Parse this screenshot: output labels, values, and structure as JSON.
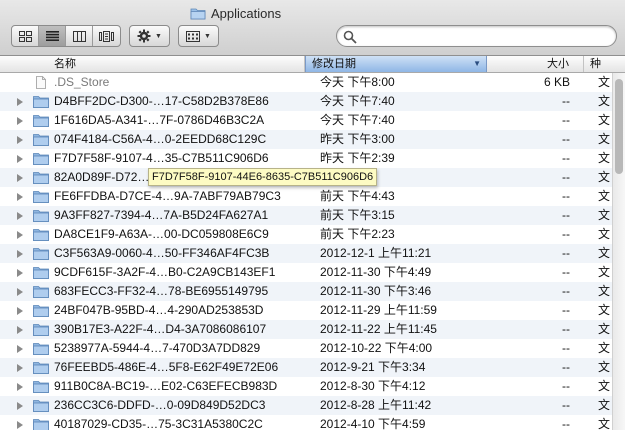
{
  "window": {
    "title": "Applications"
  },
  "toolbar": {
    "view_buttons": [
      {
        "icon": "icon-view-icon",
        "active": false
      },
      {
        "icon": "list-view-icon",
        "active": true
      },
      {
        "icon": "column-view-icon",
        "active": false
      },
      {
        "icon": "coverflow-view-icon",
        "active": false
      }
    ],
    "action_icon": "gear-icon",
    "arrange_icon": "arrange-grid-icon",
    "search": {
      "placeholder": "",
      "value": ""
    }
  },
  "columns": {
    "name": "名称",
    "date": "修改日期",
    "size": "大小",
    "kind": "种"
  },
  "tooltip": "F7D7F58F-9107-44E6-8635-C7B511C906D6",
  "rows": [
    {
      "name": ".DS_Store",
      "date": "今天 下午8:00",
      "size": "6 KB",
      "kind": "文",
      "type": "file"
    },
    {
      "name": "D4BFF2DC-D300-…17-C58D2B378E86",
      "date": "今天 下午7:40",
      "size": "--",
      "kind": "文",
      "type": "folder"
    },
    {
      "name": "1F616DA5-A341-…7F-0786D46B3C2A",
      "date": "今天 下午7:40",
      "size": "--",
      "kind": "文",
      "type": "folder"
    },
    {
      "name": "074F4184-C56A-4…0-2EEDD68C129C",
      "date": "昨天 下午3:00",
      "size": "--",
      "kind": "文",
      "type": "folder"
    },
    {
      "name": "F7D7F58F-9107-4…35-C7B511C906D6",
      "date": "昨天 下午2:39",
      "size": "--",
      "kind": "文",
      "type": "folder"
    },
    {
      "name": "82A0D89F-D72…",
      "date": "",
      "size": "--",
      "kind": "文",
      "type": "folder"
    },
    {
      "name": "FE6FFDBA-D7CE-4…9A-7ABF79AB79C3",
      "date": "前天 下午4:43",
      "size": "--",
      "kind": "文",
      "type": "folder"
    },
    {
      "name": "9A3FF827-7394-4…7A-B5D24FA627A1",
      "date": "前天 下午3:15",
      "size": "--",
      "kind": "文",
      "type": "folder"
    },
    {
      "name": "DA8CE1F9-A63A-…00-DC059808E6C9",
      "date": "前天 下午2:23",
      "size": "--",
      "kind": "文",
      "type": "folder"
    },
    {
      "name": "C3F563A9-0060-4…50-FF346AF4FC3B",
      "date": "2012-12-1 上午11:21",
      "size": "--",
      "kind": "文",
      "type": "folder"
    },
    {
      "name": "9CDF615F-3A2F-4…B0-C2A9CB143EF1",
      "date": "2012-11-30 下午4:49",
      "size": "--",
      "kind": "文",
      "type": "folder"
    },
    {
      "name": "683FECC3-FF32-4…78-BE6955149795",
      "date": "2012-11-30 下午3:46",
      "size": "--",
      "kind": "文",
      "type": "folder"
    },
    {
      "name": "24BF047B-95BD-4…4-290AD253853D",
      "date": "2012-11-29 上午11:59",
      "size": "--",
      "kind": "文",
      "type": "folder"
    },
    {
      "name": "390B17E3-A22F-4…D4-3A7086086107",
      "date": "2012-11-22 上午11:45",
      "size": "--",
      "kind": "文",
      "type": "folder"
    },
    {
      "name": "5238977A-5944-4…7-470D3A7DD829",
      "date": "2012-10-22 下午4:00",
      "size": "--",
      "kind": "文",
      "type": "folder"
    },
    {
      "name": "76FEEBD5-486E-4…5F8-E62F49E72E06",
      "date": "2012-9-21 下午3:34",
      "size": "--",
      "kind": "文",
      "type": "folder"
    },
    {
      "name": "911B0C8A-BC19-…E02-C63EFECB983D",
      "date": "2012-8-30 下午4:12",
      "size": "--",
      "kind": "文",
      "type": "folder"
    },
    {
      "name": "236CC3C6-DDFD-…0-09D849D52DC3",
      "date": "2012-8-28 上午11:42",
      "size": "--",
      "kind": "文",
      "type": "folder"
    },
    {
      "name": "40187029-CD35-…75-3C31A5380C2C",
      "date": "2012-4-10 下午4:59",
      "size": "--",
      "kind": "文",
      "type": "folder"
    }
  ],
  "colors": {
    "folder": "#8fb6e0",
    "sort_header": "#9fc0ea",
    "tooltip_bg": "#fdfbc3",
    "stripe": "#f0f4f9"
  }
}
